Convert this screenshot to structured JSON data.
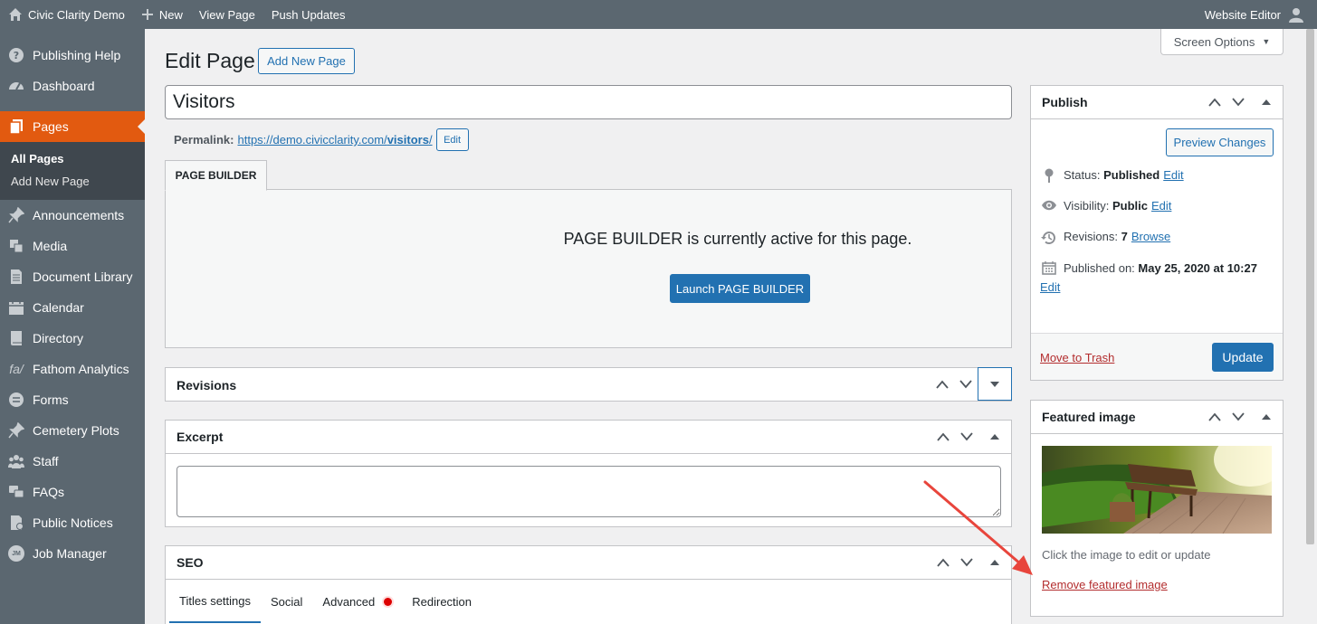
{
  "admin_bar": {
    "site_name": "Civic Clarity Demo",
    "new_label": "New",
    "view_page_label": "View Page",
    "push_updates_label": "Push Updates",
    "user_label": "Website Editor"
  },
  "sidebar": {
    "items": [
      {
        "label": "Publishing Help",
        "icon": "help-icon"
      },
      {
        "label": "Dashboard",
        "icon": "dashboard-icon"
      },
      {
        "label": "Pages",
        "icon": "pages-icon"
      },
      {
        "label": "Announcements",
        "icon": "pin-icon"
      },
      {
        "label": "Media",
        "icon": "media-icon"
      },
      {
        "label": "Document Library",
        "icon": "document-icon"
      },
      {
        "label": "Calendar",
        "icon": "calendar-icon"
      },
      {
        "label": "Directory",
        "icon": "book-icon"
      },
      {
        "label": "Fathom Analytics",
        "icon": "fathom-icon"
      },
      {
        "label": "Forms",
        "icon": "forms-icon"
      },
      {
        "label": "Cemetery Plots",
        "icon": "pin-icon"
      },
      {
        "label": "Staff",
        "icon": "staff-icon"
      },
      {
        "label": "FAQs",
        "icon": "faq-icon"
      },
      {
        "label": "Public Notices",
        "icon": "notice-icon"
      },
      {
        "label": "Job Manager",
        "icon": "jm-icon"
      }
    ],
    "submenu": {
      "all_pages": "All Pages",
      "add_new_page": "Add New Page"
    },
    "fathom_glyph": "fa/",
    "jm_glyph": "JM"
  },
  "header": {
    "screen_options": "Screen Options",
    "page_title": "Edit Page",
    "add_new_page": "Add New Page"
  },
  "editor": {
    "title_value": "Visitors",
    "permalink_label": "Permalink:",
    "permalink_base": "https://demo.civicclarity.com/",
    "permalink_slug": "visitors",
    "permalink_trail": "/",
    "permalink_edit": "Edit"
  },
  "page_builder": {
    "tab_label": "PAGE BUILDER",
    "message": "PAGE BUILDER is currently active for this page.",
    "launch_label": "Launch PAGE BUILDER"
  },
  "revisions": {
    "title": "Revisions"
  },
  "excerpt": {
    "title": "Excerpt",
    "value": ""
  },
  "seo": {
    "title": "SEO",
    "tabs": [
      "Titles settings",
      "Social",
      "Advanced",
      "Redirection"
    ]
  },
  "publish": {
    "title": "Publish",
    "preview_changes": "Preview Changes",
    "status_label": "Status:",
    "status_value": "Published",
    "visibility_label": "Visibility:",
    "visibility_value": "Public",
    "revisions_label": "Revisions:",
    "revisions_value": "7",
    "published_label": "Published on:",
    "published_value": "May 25, 2020 at 10:27",
    "edit_label": "Edit",
    "browse_label": "Browse",
    "move_to_trash": "Move to Trash",
    "update": "Update"
  },
  "featured_image": {
    "title": "Featured image",
    "caption": "Click the image to edit or update",
    "remove_label": "Remove featured image"
  },
  "colors": {
    "sidebar_bg": "#5b6770",
    "active_menu": "#e25a10",
    "primary_blue": "#2271b1",
    "trash_red": "#b32d2e",
    "annotation_arrow": "#e8453c"
  }
}
